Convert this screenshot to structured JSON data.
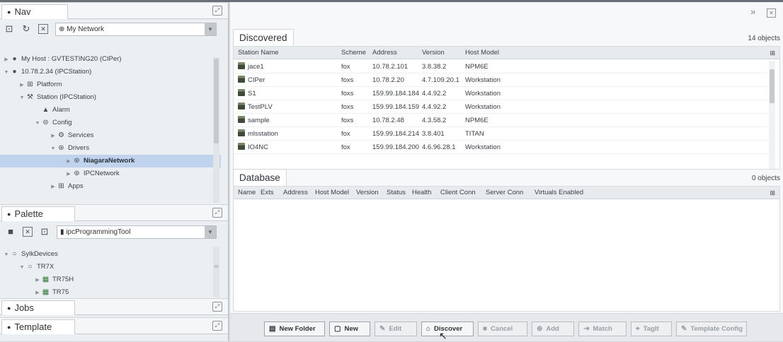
{
  "nav": {
    "title": "Nav",
    "network_select": "My Network",
    "tree": [
      {
        "label": "My Host : GVTESTING20 (CIPer)",
        "icon": "host-icon",
        "twisty": "▶"
      },
      {
        "label": "10.78.2.34 (IPCStation)",
        "icon": "host-icon",
        "twisty": "▼"
      },
      {
        "label": "Platform",
        "icon": "platform-icon",
        "twisty": "▶"
      },
      {
        "label": "Station (IPCStation)",
        "icon": "station-icon",
        "twisty": "▼"
      },
      {
        "label": "Alarm",
        "icon": "alarm-icon",
        "twisty": ""
      },
      {
        "label": "Config",
        "icon": "config-icon",
        "twisty": "▼"
      },
      {
        "label": "Services",
        "icon": "services-icon",
        "twisty": "▶"
      },
      {
        "label": "Drivers",
        "icon": "drivers-icon",
        "twisty": "▼"
      },
      {
        "label": "NiagaraNetwork",
        "icon": "network-icon",
        "twisty": "▶",
        "selected": true
      },
      {
        "label": "IPCNetwork",
        "icon": "network-icon",
        "twisty": "▶"
      },
      {
        "label": "Apps",
        "icon": "apps-icon",
        "twisty": "▶"
      }
    ]
  },
  "palette": {
    "title": "Palette",
    "module_select": "ipcProgrammingTool",
    "tree": [
      {
        "label": "SylkDevices",
        "twisty": "▼"
      },
      {
        "label": "TR7X",
        "twisty": "▼"
      },
      {
        "label": "TR75H",
        "twisty": "▶"
      },
      {
        "label": "TR75",
        "twisty": "▶"
      }
    ]
  },
  "jobs": {
    "title": "Jobs"
  },
  "template": {
    "title": "Template"
  },
  "discovered": {
    "title": "Discovered",
    "count": "14 objects",
    "columns": [
      "Station Name",
      "Scheme",
      "Address",
      "Version",
      "Host Model"
    ],
    "rows": [
      [
        "jace1",
        "fox",
        "10.78.2.101",
        "3.8.38.2",
        "NPM6E"
      ],
      [
        "CIPer",
        "foxs",
        "10.78.2.20",
        "4.7.109.20.1",
        "Workstation"
      ],
      [
        "S1",
        "foxs",
        "159.99.184.184",
        "4.4.92.2",
        "Workstation"
      ],
      [
        "TestPLV",
        "foxs",
        "159.99.184.159",
        "4.4.92.2",
        "Workstation"
      ],
      [
        "sample",
        "foxs",
        "10.78.2.48",
        "4.3.58.2",
        "NPM6E"
      ],
      [
        "mlsstation",
        "fox",
        "159.99.184.214",
        "3.8.401",
        "TITAN"
      ],
      [
        "IO4NC",
        "fox",
        "159.99.184.200",
        "4.6.96.28.1",
        "Workstation"
      ]
    ]
  },
  "database": {
    "title": "Database",
    "count": "0 objects",
    "columns": [
      "Name",
      "Exts",
      "Address",
      "Host Model",
      "Version",
      "Status",
      "Health",
      "Client Conn",
      "Server Conn",
      "Virtuals Enabled"
    ]
  },
  "buttons": [
    {
      "label": "New Folder",
      "icon": "folder-icon",
      "enabled": true
    },
    {
      "label": "New",
      "icon": "new-icon",
      "enabled": true
    },
    {
      "label": "Edit",
      "icon": "edit-icon",
      "enabled": false
    },
    {
      "label": "Discover",
      "icon": "discover-icon",
      "enabled": true
    },
    {
      "label": "Cancel",
      "icon": "cancel-icon",
      "enabled": false
    },
    {
      "label": "Add",
      "icon": "add-icon",
      "enabled": false
    },
    {
      "label": "Match",
      "icon": "match-icon",
      "enabled": false
    },
    {
      "label": "TagIt",
      "icon": "tag-icon",
      "enabled": false
    },
    {
      "label": "Template Config",
      "icon": "template-config-icon",
      "enabled": false
    }
  ]
}
